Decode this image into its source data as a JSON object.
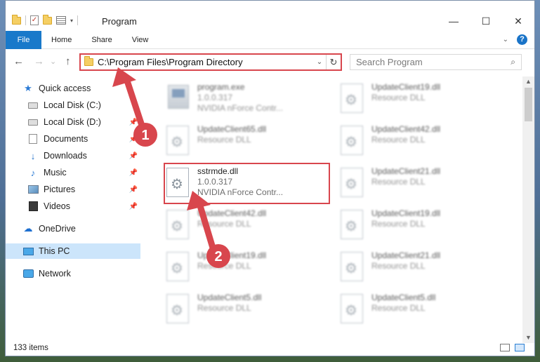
{
  "window": {
    "title": "Program",
    "controls": {
      "minimize": "—",
      "maximize": "☐",
      "close": "✕"
    }
  },
  "quick_access_toolbar": {
    "dropdown": "▾"
  },
  "ribbon": {
    "tabs": [
      "File",
      "Home",
      "Share",
      "View"
    ],
    "help": "?"
  },
  "navigation": {
    "back": "←",
    "forward": "→",
    "dropdown": "⌄",
    "up": "↑",
    "address": "C:\\Program Files\\Program Directory",
    "address_dropdown": "⌄",
    "refresh": "↻",
    "search_placeholder": "Search Program",
    "search_icon": "⌕"
  },
  "sidebar": {
    "items": [
      {
        "label": "Quick access",
        "icon": "star-icon",
        "pinned": false
      },
      {
        "label": "Local Disk (C:)",
        "icon": "drive-icon",
        "pinned": false
      },
      {
        "label": "Local Disk (D:)",
        "icon": "drive-icon",
        "pinned": true
      },
      {
        "label": "Documents",
        "icon": "documents-icon",
        "pinned": true
      },
      {
        "label": "Downloads",
        "icon": "download-icon",
        "pinned": true
      },
      {
        "label": "Music",
        "icon": "music-icon",
        "pinned": true
      },
      {
        "label": "Pictures",
        "icon": "pictures-icon",
        "pinned": true
      },
      {
        "label": "Videos",
        "icon": "videos-icon",
        "pinned": true
      },
      {
        "label": "OneDrive",
        "icon": "cloud-icon",
        "pinned": false
      },
      {
        "label": "This PC",
        "icon": "computer-icon",
        "pinned": false,
        "selected": true
      },
      {
        "label": "Network",
        "icon": "network-icon",
        "pinned": false
      }
    ]
  },
  "files": [
    {
      "name": "program.exe",
      "line2": "1.0.0.317",
      "line3": "NVIDIA nForce Contr...",
      "blurred": true
    },
    {
      "name": "UpdateClient19.dll",
      "line2": "Resource DLL",
      "blurred": true
    },
    {
      "name": "UpdateClient65.dll",
      "line2": "Resource DLL",
      "blurred": true
    },
    {
      "name": "UpdateClient42.dll",
      "line2": "Resource DLL",
      "blurred": true
    },
    {
      "name": "sstrmde.dll",
      "line2": "1.0.0.317",
      "line3": "NVIDIA nForce Contr...",
      "blurred": false
    },
    {
      "name": "UpdateClient21.dll",
      "line2": "Resource DLL",
      "blurred": true
    },
    {
      "name": "UpdateClient42.dll",
      "line2": "Resource DLL",
      "blurred": true
    },
    {
      "name": "UpdateClient19.dll",
      "line2": "Resource DLL",
      "blurred": true
    },
    {
      "name": "UpdateClient19.dll",
      "line2": "Resource DLL",
      "blurred": true
    },
    {
      "name": "UpdateClient21.dll",
      "line2": "Resource DLL",
      "blurred": true
    },
    {
      "name": "UpdateClient5.dll",
      "line2": "Resource DLL",
      "blurred": true
    },
    {
      "name": "UpdateClient5.dll",
      "line2": "Resource DLL",
      "blurred": true
    }
  ],
  "status_bar": {
    "item_count": "133 items"
  },
  "scrollbar": {
    "up": "▲",
    "down": "▼"
  },
  "annotations": {
    "step1": "1",
    "step2": "2",
    "color": "#d8464d"
  },
  "colors": {
    "accent": "#1979ca",
    "highlight": "#d8464d",
    "selected": "#cce5fb"
  }
}
